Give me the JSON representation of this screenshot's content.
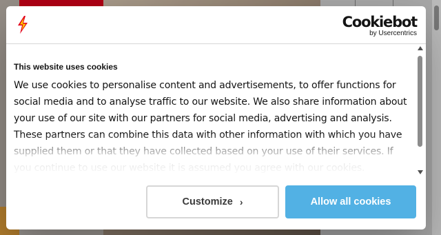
{
  "dialog": {
    "brand_logo": "cookiebot-logo",
    "brand_name": "Cookiebot",
    "brand_sub": "by Usercentrics",
    "site_logo_icon": "lightning-bolt-icon",
    "title": "This website uses cookies",
    "text": "We use cookies to personalise content and advertisements, to offer functions for social media and to analyse traffic to our website. We also share information about your use of our site with our partners for social media, advertising and analysis. These partners can combine this data with other information with which you have supplied them or that they have collected based on your use of their services. If you continue to use our website it is assumed you agree with our cookies.",
    "buttons": {
      "customize": "Customize",
      "customize_icon": "chevron-right-icon",
      "allow_all": "Allow all cookies"
    },
    "colors": {
      "accent": "#52b1e4",
      "bolt_red": "#e2001a",
      "bolt_yellow": "#ffcc00"
    }
  }
}
